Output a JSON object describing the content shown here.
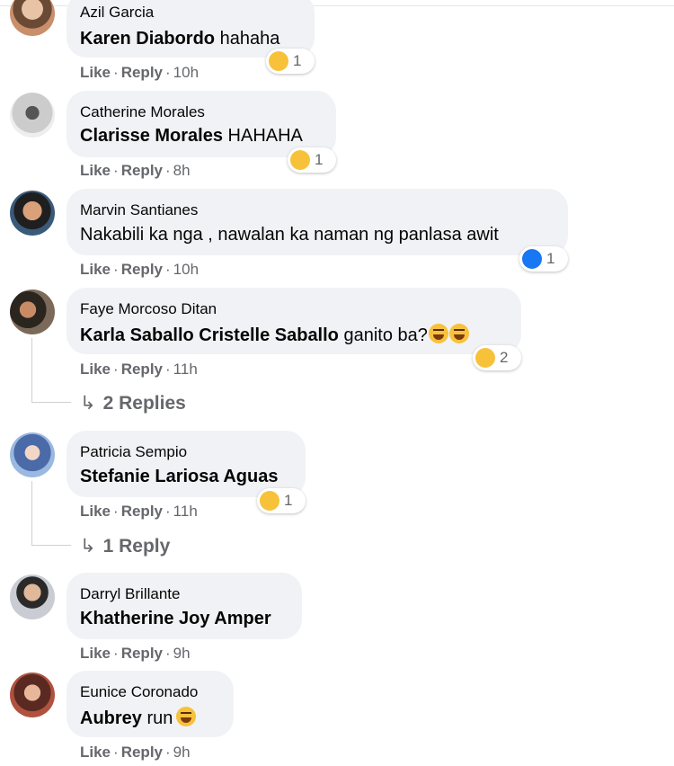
{
  "comments": [
    {
      "name": "Azil Garcia",
      "tag": "Karen Diabordo",
      "text": " hahaha",
      "like": "Like",
      "reply": "Reply",
      "time": "10h",
      "reaction_count": "1",
      "reaction": "wow",
      "avatar_color": "#c98f6b"
    },
    {
      "name": "Catherine Morales",
      "tag": "Clarisse Morales",
      "text": " HAHAHA",
      "like": "Like",
      "reply": "Reply",
      "time": "8h",
      "reaction_count": "1",
      "reaction": "haha",
      "avatar_color": "#d9d9d9"
    },
    {
      "name": "Marvin Santianes",
      "tag": "",
      "text": "Nakabili ka nga , nawalan ka naman ng panlasa awit",
      "like": "Like",
      "reply": "Reply",
      "time": "10h",
      "reaction_count": "1",
      "reaction": "like",
      "avatar_color": "#4a3a30"
    },
    {
      "name": "Faye Morcoso Ditan",
      "tag": "Karla Saballo Cristelle Saballo",
      "text": " ganito ba?",
      "like": "Like",
      "reply": "Reply",
      "time": "11h",
      "reaction_count": "2",
      "reaction": "haha",
      "replies": "2 Replies",
      "avatar_color": "#5b4a3f"
    },
    {
      "name": "Patricia Sempio",
      "tag": "Stefanie Lariosa Aguas",
      "text": "",
      "like": "Like",
      "reply": "Reply",
      "time": "11h",
      "reaction_count": "1",
      "reaction": "haha",
      "replies": "1 Reply",
      "avatar_color": "#6f8fc9"
    },
    {
      "name": "Darryl Brillante",
      "tag": "Khatherine Joy Amper",
      "text": "",
      "like": "Like",
      "reply": "Reply",
      "time": "9h",
      "avatar_color": "#8a8f9a"
    },
    {
      "name": "Eunice Coronado",
      "tag": "Aubrey",
      "text": " run",
      "like": "Like",
      "reply": "Reply",
      "time": "9h",
      "avatar_color": "#9b4a3a"
    }
  ],
  "sep": "·",
  "reply_arrow": "↳"
}
